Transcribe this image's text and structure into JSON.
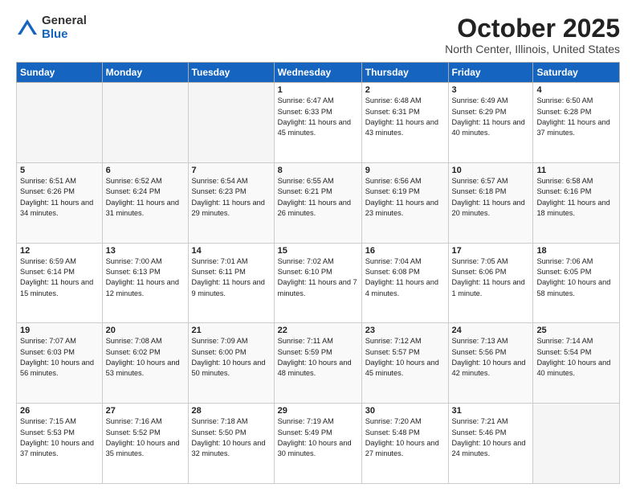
{
  "logo": {
    "general": "General",
    "blue": "Blue"
  },
  "title": "October 2025",
  "location": "North Center, Illinois, United States",
  "days_of_week": [
    "Sunday",
    "Monday",
    "Tuesday",
    "Wednesday",
    "Thursday",
    "Friday",
    "Saturday"
  ],
  "weeks": [
    [
      {
        "day": "",
        "info": ""
      },
      {
        "day": "",
        "info": ""
      },
      {
        "day": "",
        "info": ""
      },
      {
        "day": "1",
        "info": "Sunrise: 6:47 AM\nSunset: 6:33 PM\nDaylight: 11 hours and 45 minutes."
      },
      {
        "day": "2",
        "info": "Sunrise: 6:48 AM\nSunset: 6:31 PM\nDaylight: 11 hours and 43 minutes."
      },
      {
        "day": "3",
        "info": "Sunrise: 6:49 AM\nSunset: 6:29 PM\nDaylight: 11 hours and 40 minutes."
      },
      {
        "day": "4",
        "info": "Sunrise: 6:50 AM\nSunset: 6:28 PM\nDaylight: 11 hours and 37 minutes."
      }
    ],
    [
      {
        "day": "5",
        "info": "Sunrise: 6:51 AM\nSunset: 6:26 PM\nDaylight: 11 hours and 34 minutes."
      },
      {
        "day": "6",
        "info": "Sunrise: 6:52 AM\nSunset: 6:24 PM\nDaylight: 11 hours and 31 minutes."
      },
      {
        "day": "7",
        "info": "Sunrise: 6:54 AM\nSunset: 6:23 PM\nDaylight: 11 hours and 29 minutes."
      },
      {
        "day": "8",
        "info": "Sunrise: 6:55 AM\nSunset: 6:21 PM\nDaylight: 11 hours and 26 minutes."
      },
      {
        "day": "9",
        "info": "Sunrise: 6:56 AM\nSunset: 6:19 PM\nDaylight: 11 hours and 23 minutes."
      },
      {
        "day": "10",
        "info": "Sunrise: 6:57 AM\nSunset: 6:18 PM\nDaylight: 11 hours and 20 minutes."
      },
      {
        "day": "11",
        "info": "Sunrise: 6:58 AM\nSunset: 6:16 PM\nDaylight: 11 hours and 18 minutes."
      }
    ],
    [
      {
        "day": "12",
        "info": "Sunrise: 6:59 AM\nSunset: 6:14 PM\nDaylight: 11 hours and 15 minutes."
      },
      {
        "day": "13",
        "info": "Sunrise: 7:00 AM\nSunset: 6:13 PM\nDaylight: 11 hours and 12 minutes."
      },
      {
        "day": "14",
        "info": "Sunrise: 7:01 AM\nSunset: 6:11 PM\nDaylight: 11 hours and 9 minutes."
      },
      {
        "day": "15",
        "info": "Sunrise: 7:02 AM\nSunset: 6:10 PM\nDaylight: 11 hours and 7 minutes."
      },
      {
        "day": "16",
        "info": "Sunrise: 7:04 AM\nSunset: 6:08 PM\nDaylight: 11 hours and 4 minutes."
      },
      {
        "day": "17",
        "info": "Sunrise: 7:05 AM\nSunset: 6:06 PM\nDaylight: 11 hours and 1 minute."
      },
      {
        "day": "18",
        "info": "Sunrise: 7:06 AM\nSunset: 6:05 PM\nDaylight: 10 hours and 58 minutes."
      }
    ],
    [
      {
        "day": "19",
        "info": "Sunrise: 7:07 AM\nSunset: 6:03 PM\nDaylight: 10 hours and 56 minutes."
      },
      {
        "day": "20",
        "info": "Sunrise: 7:08 AM\nSunset: 6:02 PM\nDaylight: 10 hours and 53 minutes."
      },
      {
        "day": "21",
        "info": "Sunrise: 7:09 AM\nSunset: 6:00 PM\nDaylight: 10 hours and 50 minutes."
      },
      {
        "day": "22",
        "info": "Sunrise: 7:11 AM\nSunset: 5:59 PM\nDaylight: 10 hours and 48 minutes."
      },
      {
        "day": "23",
        "info": "Sunrise: 7:12 AM\nSunset: 5:57 PM\nDaylight: 10 hours and 45 minutes."
      },
      {
        "day": "24",
        "info": "Sunrise: 7:13 AM\nSunset: 5:56 PM\nDaylight: 10 hours and 42 minutes."
      },
      {
        "day": "25",
        "info": "Sunrise: 7:14 AM\nSunset: 5:54 PM\nDaylight: 10 hours and 40 minutes."
      }
    ],
    [
      {
        "day": "26",
        "info": "Sunrise: 7:15 AM\nSunset: 5:53 PM\nDaylight: 10 hours and 37 minutes."
      },
      {
        "day": "27",
        "info": "Sunrise: 7:16 AM\nSunset: 5:52 PM\nDaylight: 10 hours and 35 minutes."
      },
      {
        "day": "28",
        "info": "Sunrise: 7:18 AM\nSunset: 5:50 PM\nDaylight: 10 hours and 32 minutes."
      },
      {
        "day": "29",
        "info": "Sunrise: 7:19 AM\nSunset: 5:49 PM\nDaylight: 10 hours and 30 minutes."
      },
      {
        "day": "30",
        "info": "Sunrise: 7:20 AM\nSunset: 5:48 PM\nDaylight: 10 hours and 27 minutes."
      },
      {
        "day": "31",
        "info": "Sunrise: 7:21 AM\nSunset: 5:46 PM\nDaylight: 10 hours and 24 minutes."
      },
      {
        "day": "",
        "info": ""
      }
    ]
  ]
}
